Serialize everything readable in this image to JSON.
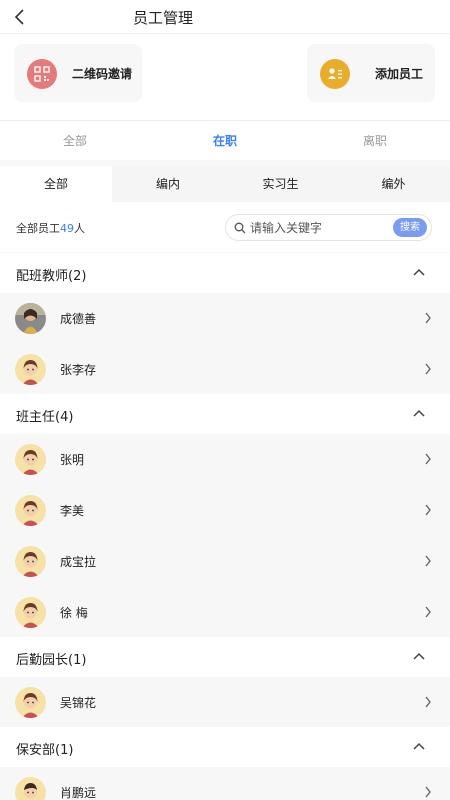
{
  "header": {
    "title": "员工管理"
  },
  "actions": {
    "qr_label": "二维码邀请",
    "add_label": "添加员工"
  },
  "status_tabs": [
    {
      "label": "全部"
    },
    {
      "label": "在职"
    },
    {
      "label": "离职"
    }
  ],
  "type_tabs": [
    {
      "label": "全部"
    },
    {
      "label": "编内"
    },
    {
      "label": "实习生"
    },
    {
      "label": "编外"
    }
  ],
  "summary": {
    "prefix": "全部员工",
    "count": "49",
    "suffix": "人"
  },
  "search": {
    "placeholder": "请输入关键字",
    "button": "搜索"
  },
  "groups": [
    {
      "name": "配班教师(2)",
      "members": [
        {
          "name": "成德善"
        },
        {
          "name": "张李存"
        }
      ]
    },
    {
      "name": "班主任(4)",
      "members": [
        {
          "name": "张明"
        },
        {
          "name": "李美"
        },
        {
          "name": "成宝拉"
        },
        {
          "name": "徐 梅"
        }
      ]
    },
    {
      "name": "后勤园长(1)",
      "members": [
        {
          "name": "吴锦花"
        }
      ]
    },
    {
      "name": "保安部(1)",
      "members": [
        {
          "name": "肖鹏远"
        }
      ]
    }
  ]
}
